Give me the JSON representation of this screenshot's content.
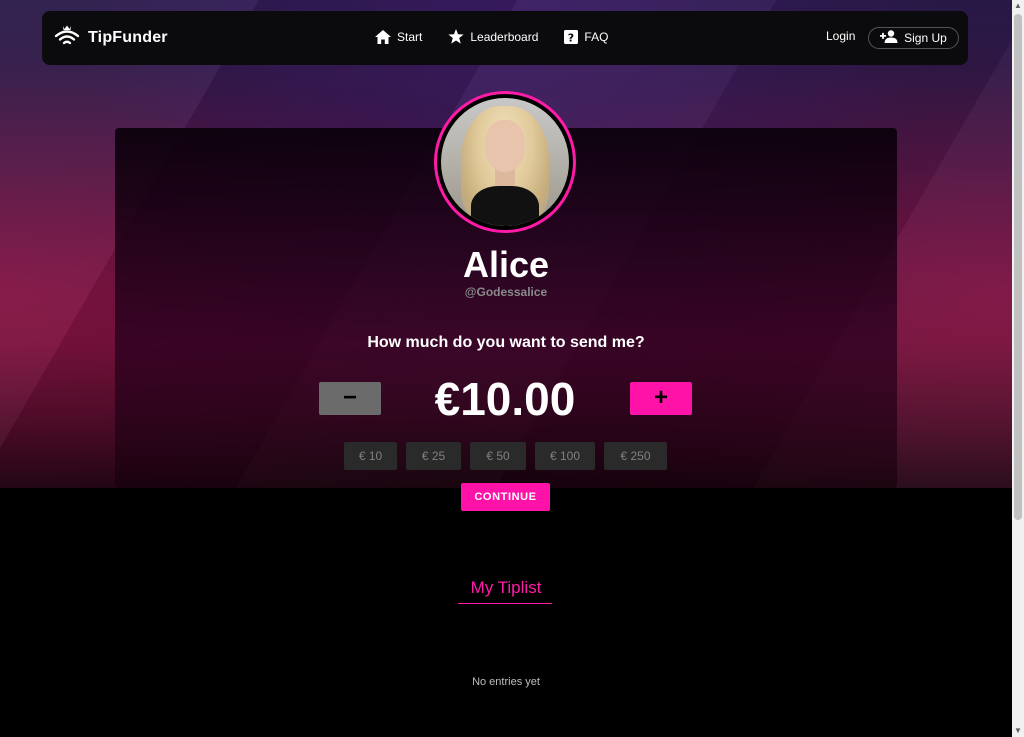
{
  "brand": {
    "name": "TipFunder",
    "icon": "crown-wifi-logo-icon"
  },
  "nav": {
    "items": [
      {
        "label": "Start",
        "icon": "home-icon"
      },
      {
        "label": "Leaderboard",
        "icon": "star-icon"
      },
      {
        "label": "FAQ",
        "icon": "question-icon"
      }
    ],
    "login_label": "Login",
    "signup_label": "Sign Up",
    "signup_icon": "add-user-icon"
  },
  "profile": {
    "name": "Alice",
    "handle": "@Godessalice"
  },
  "tip": {
    "question": "How much do you want to send me?",
    "amount": "€10.00",
    "minus_label": "−",
    "plus_label": "+",
    "presets": [
      "€ 10",
      "€ 25",
      "€ 50",
      "€ 100",
      "€ 250"
    ],
    "continue_label": "CONTINUE"
  },
  "tiplist": {
    "title": "My Tiplist",
    "empty_text": "No entries yet"
  },
  "colors": {
    "accent": "#ff12a8",
    "navbar": "#0b0b0d",
    "muted_button": "#6b6b6b",
    "preset_bg": "#2a2a2a"
  }
}
